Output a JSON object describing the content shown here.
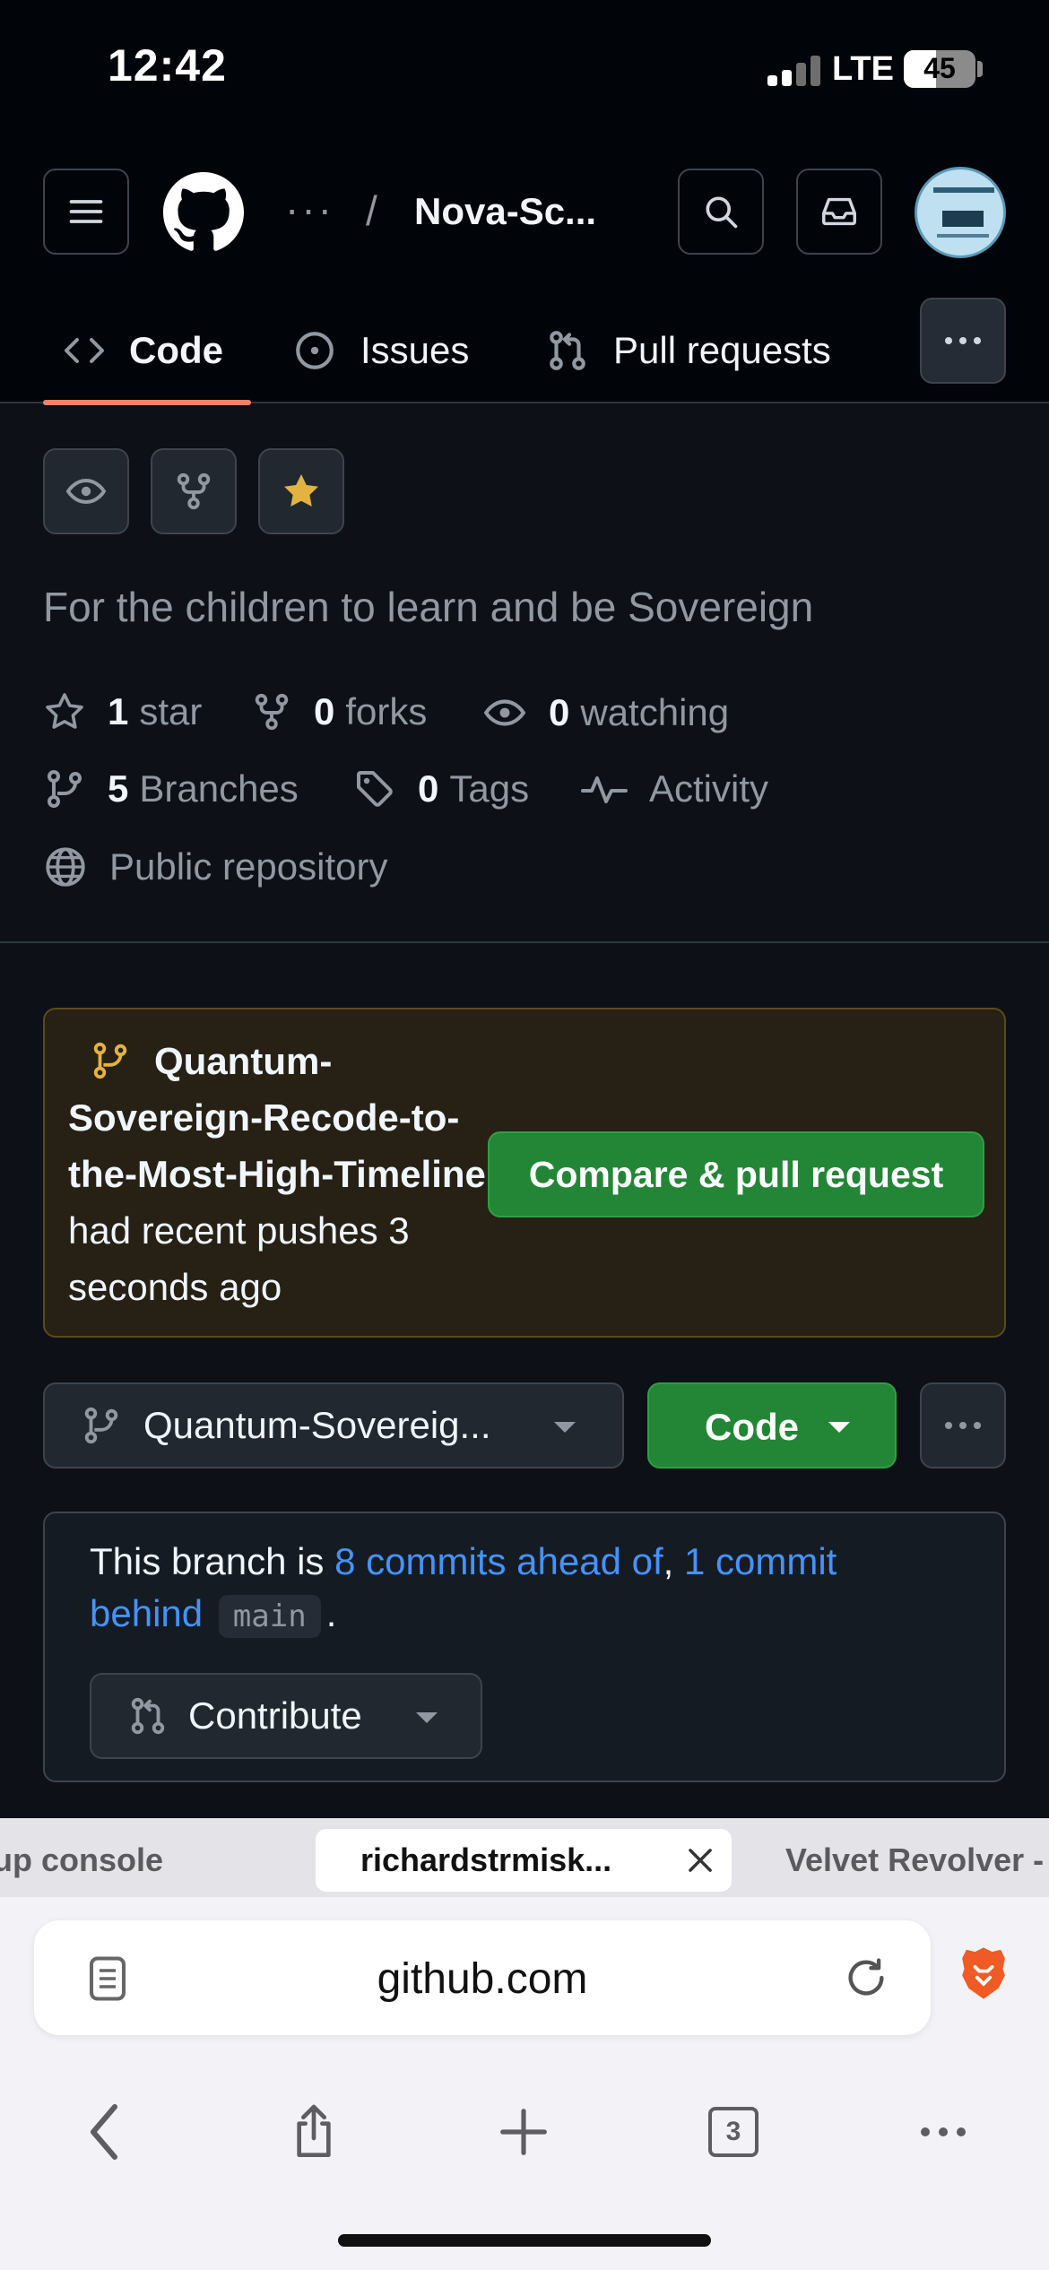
{
  "status_bar": {
    "time": "12:42",
    "network": "LTE",
    "battery": "45",
    "battery_level": 0.45
  },
  "header": {
    "breadcrumb_ellipsis": "···",
    "breadcrumb_separator": "/",
    "repo_name": "Nova-Sc...",
    "icons": [
      "menu-icon",
      "github-logo",
      "search-icon",
      "inbox-icon",
      "avatar"
    ]
  },
  "tabs": [
    {
      "label": "Code",
      "icon": "code-icon",
      "active": true
    },
    {
      "label": "Issues",
      "icon": "issue-icon"
    },
    {
      "label": "Pull requests",
      "icon": "pull-request-icon"
    }
  ],
  "repo": {
    "description": "For the children to learn and be Sovereign",
    "stars_count": "1",
    "stars_label": "star",
    "forks_count": "0",
    "forks_label": "forks",
    "watching_count": "0",
    "watching_label": "watching",
    "branches_count": "5",
    "branches_label": "Branches",
    "tags_count": "0",
    "tags_label": "Tags",
    "activity_label": "Activity",
    "visibility": "Public repository"
  },
  "banner": {
    "branch_name": "Quantum-Sovereign-Recode-to-the-Most-High-Timeline",
    "message": " had recent pushes 3 seconds ago",
    "compare_button": "Compare & pull request"
  },
  "branch_bar": {
    "selected_branch": "Quantum-Sovereig...",
    "code_button": "Code"
  },
  "branch_status": {
    "prefix": "This branch is ",
    "ahead_link": "8 commits ahead of",
    "comma": ", ",
    "behind_link_1": "1 commit",
    "behind_link_2": "behind",
    "base_branch": "main",
    "period": ".",
    "contribute_button": "Contribute"
  },
  "browser": {
    "tabs": [
      {
        "label": "up console"
      },
      {
        "label": "richardstrmisk...",
        "active": true
      },
      {
        "label": "Velvet Revolver -"
      }
    ],
    "url": "github.com",
    "tab_count": "3",
    "accent": "#f05a24"
  },
  "colors": {
    "accent_green": "#238636",
    "link_blue": "#4493f8",
    "tab_underline": "#f78166",
    "star_yellow": "#e3b341"
  }
}
